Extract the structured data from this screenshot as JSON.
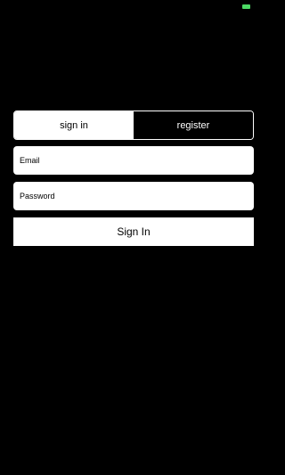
{
  "status_bar": {
    "battery_color": "#4cd964",
    "battery_icon": "battery-icon"
  },
  "auth_tabs": {
    "sign_in_label": "sign in",
    "register_label": "register",
    "selected": "sign in"
  },
  "form": {
    "email_placeholder": "Email",
    "email_value": "",
    "password_placeholder": "Password",
    "password_value": "",
    "submit_label": "Sign In"
  },
  "colors": {
    "background": "#000000",
    "surface": "#ffffff",
    "text_dark": "#000000",
    "text_light": "#ffffff"
  }
}
